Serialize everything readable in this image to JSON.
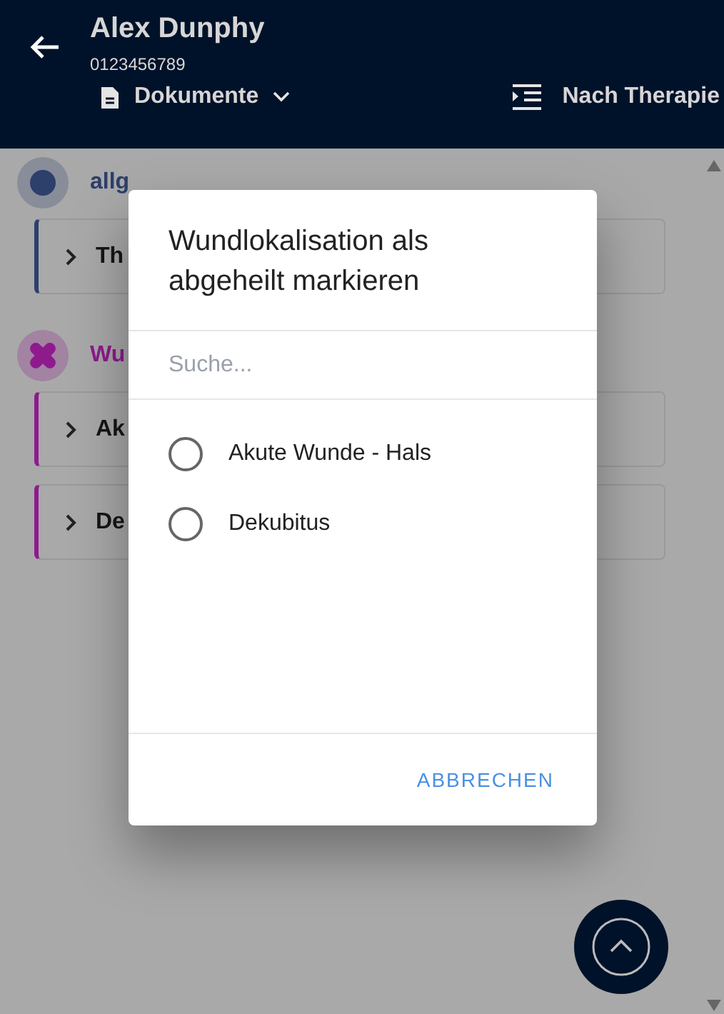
{
  "header": {
    "name": "Alex Dunphy",
    "patient_id": "0123456789",
    "documents_menu": "Dokumente",
    "sort_button": "Nach Therapie"
  },
  "sections": [
    {
      "label": "allg",
      "kind": "dot",
      "color": "#2d3f6b",
      "cards": [
        {
          "label": "Th"
        }
      ]
    },
    {
      "label": "Wu",
      "kind": "bandage",
      "color": "#8e1a8e",
      "cards": [
        {
          "label": "Ak"
        },
        {
          "label": "De"
        }
      ]
    }
  ],
  "dialog": {
    "title": "Wundlokalisation als abgeheilt markieren",
    "search": {
      "placeholder": "Suche..."
    },
    "options": [
      {
        "label": "Akute Wunde - Hals",
        "selected": false
      },
      {
        "label": "Dekubitus",
        "selected": false
      }
    ],
    "cancel_button": "ABBRECHEN"
  }
}
